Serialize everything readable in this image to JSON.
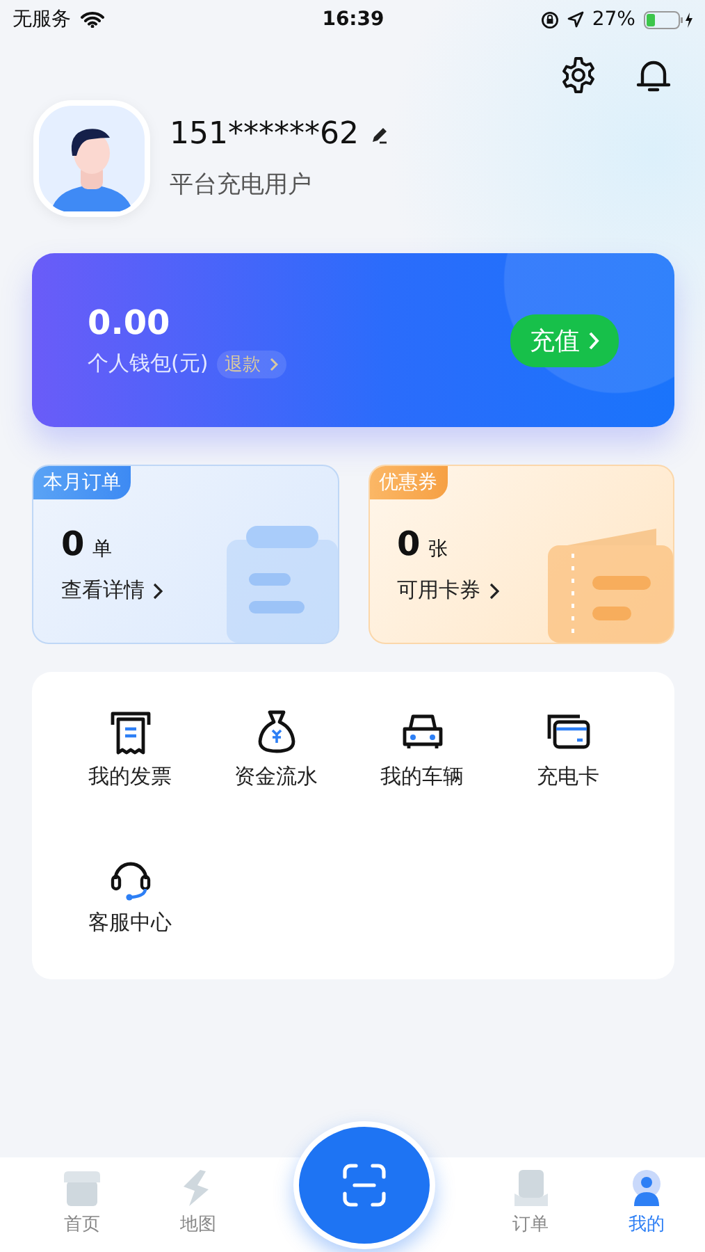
{
  "status_bar": {
    "carrier": "无服务",
    "time": "16:39",
    "battery": "27%"
  },
  "profile": {
    "phone": "151******62",
    "role": "平台充电用户"
  },
  "wallet": {
    "amount": "0.00",
    "label": "个人钱包(元)",
    "refund": "退款",
    "recharge": "充值"
  },
  "stats": [
    {
      "kind": "orders",
      "tag": "本月订单",
      "count": "0",
      "unit": "单",
      "link": "查看详情"
    },
    {
      "kind": "coupons",
      "tag": "优惠券",
      "count": "0",
      "unit": "张",
      "link": "可用卡券"
    }
  ],
  "services": [
    {
      "kind": "invoice",
      "label": "我的发票"
    },
    {
      "kind": "money",
      "label": "资金流水"
    },
    {
      "kind": "car",
      "label": "我的车辆"
    },
    {
      "kind": "card",
      "label": "充电卡"
    },
    {
      "kind": "headset",
      "label": "客服中心"
    }
  ],
  "tabs": [
    {
      "kind": "home",
      "label": "首页",
      "selected": false
    },
    {
      "kind": "map",
      "label": "地图",
      "selected": false
    },
    {
      "kind": "orders",
      "label": "订单",
      "selected": false
    },
    {
      "kind": "me",
      "label": "我的",
      "selected": true
    }
  ]
}
